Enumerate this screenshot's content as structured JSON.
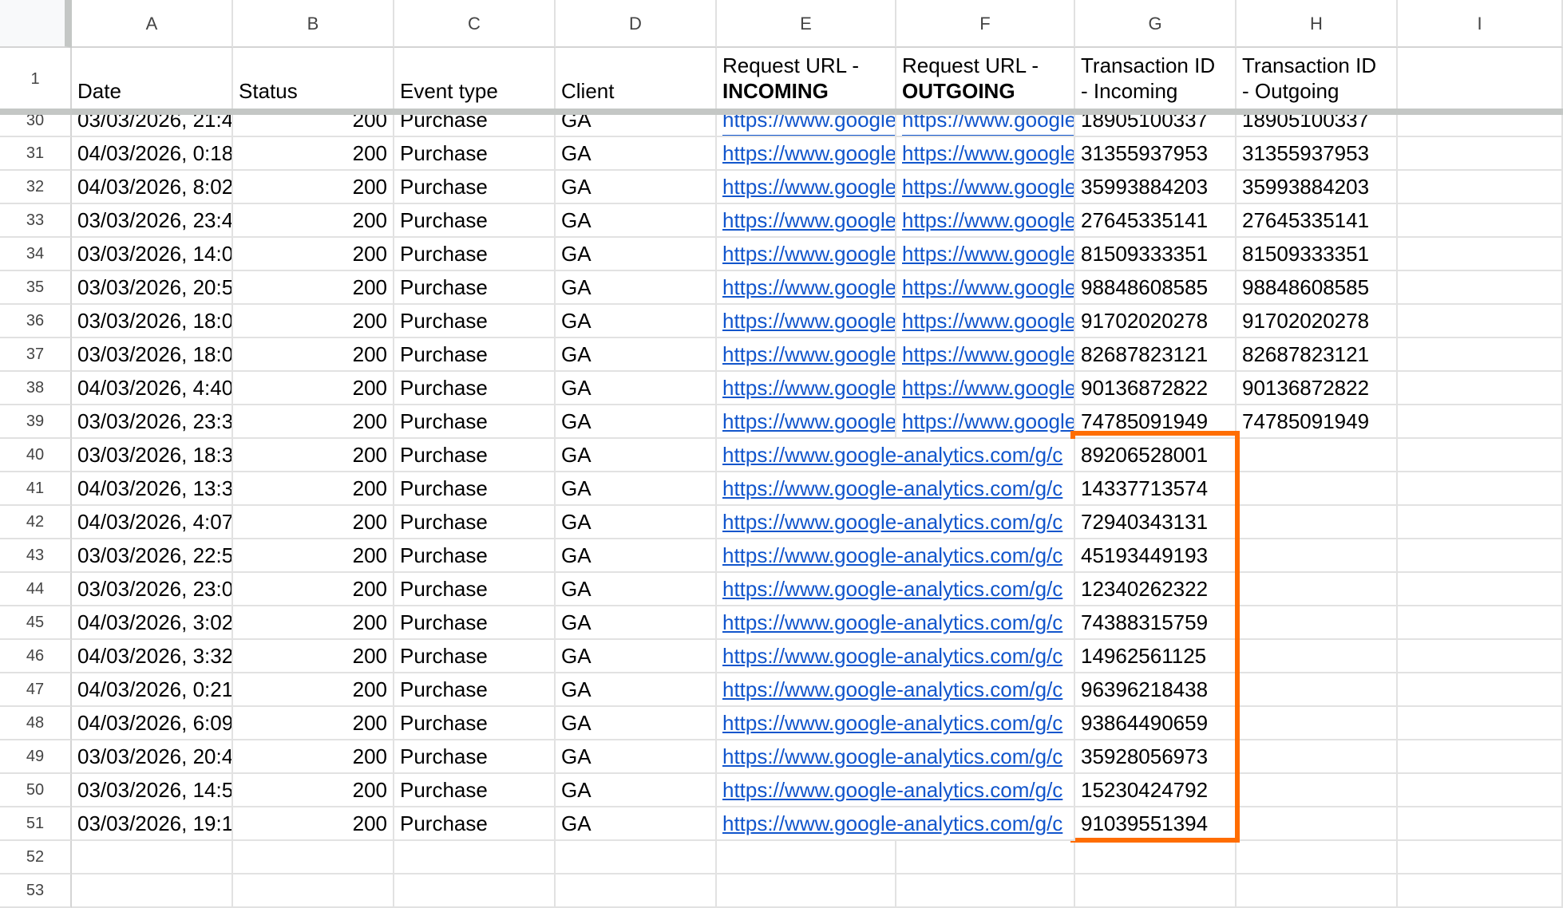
{
  "columns": [
    "A",
    "B",
    "C",
    "D",
    "E",
    "F",
    "G",
    "H",
    "I"
  ],
  "header": {
    "date": "Date",
    "status": "Status",
    "event_type": "Event type",
    "client": "Client",
    "req_in_line1": "Request URL -",
    "req_in_line2": "INCOMING",
    "req_out_line1": "Request URL -",
    "req_out_line2": "OUTGOING",
    "tx_in_line1": "Transaction ID",
    "tx_in_line2": "- Incoming",
    "tx_out_line1": "Transaction ID",
    "tx_out_line2": "- Outgoing"
  },
  "rows": [
    {
      "n": "30",
      "date": "03/03/2026, 21:4",
      "status": "200",
      "event": "Purchase",
      "client": "GA",
      "url_in": "https://www.google",
      "url_out": "https://www.google",
      "tx_in": "18905100337",
      "tx_out": "18905100337"
    },
    {
      "n": "31",
      "date": "04/03/2026, 0:18",
      "status": "200",
      "event": "Purchase",
      "client": "GA",
      "url_in": "https://www.google",
      "url_out": "https://www.google",
      "tx_in": "31355937953",
      "tx_out": "31355937953"
    },
    {
      "n": "32",
      "date": "04/03/2026, 8:02",
      "status": "200",
      "event": "Purchase",
      "client": "GA",
      "url_in": "https://www.google",
      "url_out": "https://www.google",
      "tx_in": "35993884203",
      "tx_out": "35993884203"
    },
    {
      "n": "33",
      "date": "03/03/2026, 23:4",
      "status": "200",
      "event": "Purchase",
      "client": "GA",
      "url_in": "https://www.google",
      "url_out": "https://www.google",
      "tx_in": "27645335141",
      "tx_out": "27645335141"
    },
    {
      "n": "34",
      "date": "03/03/2026, 14:0",
      "status": "200",
      "event": "Purchase",
      "client": "GA",
      "url_in": "https://www.google",
      "url_out": "https://www.google",
      "tx_in": "81509333351",
      "tx_out": "81509333351"
    },
    {
      "n": "35",
      "date": "03/03/2026, 20:5",
      "status": "200",
      "event": "Purchase",
      "client": "GA",
      "url_in": "https://www.google",
      "url_out": "https://www.google",
      "tx_in": "98848608585",
      "tx_out": "98848608585"
    },
    {
      "n": "36",
      "date": "03/03/2026, 18:0",
      "status": "200",
      "event": "Purchase",
      "client": "GA",
      "url_in": "https://www.google",
      "url_out": "https://www.google",
      "tx_in": "91702020278",
      "tx_out": "91702020278"
    },
    {
      "n": "37",
      "date": "03/03/2026, 18:0",
      "status": "200",
      "event": "Purchase",
      "client": "GA",
      "url_in": "https://www.google",
      "url_out": "https://www.google",
      "tx_in": "82687823121",
      "tx_out": "82687823121"
    },
    {
      "n": "38",
      "date": "04/03/2026, 4:40",
      "status": "200",
      "event": "Purchase",
      "client": "GA",
      "url_in": "https://www.google",
      "url_out": "https://www.google",
      "tx_in": "90136872822",
      "tx_out": "90136872822"
    },
    {
      "n": "39",
      "date": "03/03/2026, 23:3",
      "status": "200",
      "event": "Purchase",
      "client": "GA",
      "url_in": "https://www.google",
      "url_out": "https://www.google",
      "tx_in": "74785091949",
      "tx_out": "74785091949"
    },
    {
      "n": "40",
      "date": "03/03/2026, 18:3",
      "status": "200",
      "event": "Purchase",
      "client": "GA",
      "url_in": "https://www.google-analytics.com/g/c",
      "url_out": "",
      "tx_in": "89206528001",
      "tx_out": ""
    },
    {
      "n": "41",
      "date": "04/03/2026, 13:3",
      "status": "200",
      "event": "Purchase",
      "client": "GA",
      "url_in": "https://www.google-analytics.com/g/c",
      "url_out": "",
      "tx_in": "14337713574",
      "tx_out": ""
    },
    {
      "n": "42",
      "date": "04/03/2026, 4:07",
      "status": "200",
      "event": "Purchase",
      "client": "GA",
      "url_in": "https://www.google-analytics.com/g/c",
      "url_out": "",
      "tx_in": "72940343131",
      "tx_out": ""
    },
    {
      "n": "43",
      "date": "03/03/2026, 22:5",
      "status": "200",
      "event": "Purchase",
      "client": "GA",
      "url_in": "https://www.google-analytics.com/g/c",
      "url_out": "",
      "tx_in": "45193449193",
      "tx_out": ""
    },
    {
      "n": "44",
      "date": "03/03/2026, 23:0",
      "status": "200",
      "event": "Purchase",
      "client": "GA",
      "url_in": "https://www.google-analytics.com/g/c",
      "url_out": "",
      "tx_in": "12340262322",
      "tx_out": ""
    },
    {
      "n": "45",
      "date": "04/03/2026, 3:02",
      "status": "200",
      "event": "Purchase",
      "client": "GA",
      "url_in": "https://www.google-analytics.com/g/c",
      "url_out": "",
      "tx_in": "74388315759",
      "tx_out": ""
    },
    {
      "n": "46",
      "date": "04/03/2026, 3:32",
      "status": "200",
      "event": "Purchase",
      "client": "GA",
      "url_in": "https://www.google-analytics.com/g/c",
      "url_out": "",
      "tx_in": "14962561125",
      "tx_out": ""
    },
    {
      "n": "47",
      "date": "04/03/2026, 0:21",
      "status": "200",
      "event": "Purchase",
      "client": "GA",
      "url_in": "https://www.google-analytics.com/g/c",
      "url_out": "",
      "tx_in": "96396218438",
      "tx_out": ""
    },
    {
      "n": "48",
      "date": "04/03/2026, 6:09",
      "status": "200",
      "event": "Purchase",
      "client": "GA",
      "url_in": "https://www.google-analytics.com/g/c",
      "url_out": "",
      "tx_in": "93864490659",
      "tx_out": ""
    },
    {
      "n": "49",
      "date": "03/03/2026, 20:4",
      "status": "200",
      "event": "Purchase",
      "client": "GA",
      "url_in": "https://www.google-analytics.com/g/c",
      "url_out": "",
      "tx_in": "35928056973",
      "tx_out": ""
    },
    {
      "n": "50",
      "date": "03/03/2026, 14:5",
      "status": "200",
      "event": "Purchase",
      "client": "GA",
      "url_in": "https://www.google-analytics.com/g/c",
      "url_out": "",
      "tx_in": "15230424792",
      "tx_out": ""
    },
    {
      "n": "51",
      "date": "03/03/2026, 19:1",
      "status": "200",
      "event": "Purchase",
      "client": "GA",
      "url_in": "https://www.google-analytics.com/g/c",
      "url_out": "",
      "tx_in": "91039551394",
      "tx_out": ""
    },
    {
      "n": "52",
      "date": "",
      "status": "",
      "event": "",
      "client": "",
      "url_in": "",
      "url_out": "",
      "tx_in": "",
      "tx_out": ""
    },
    {
      "n": "53",
      "date": "",
      "status": "",
      "event": "",
      "client": "",
      "url_in": "",
      "url_out": "",
      "tx_in": "",
      "tx_out": ""
    }
  ],
  "highlight_color": "#ff6d01",
  "link_color": "#1155cc"
}
